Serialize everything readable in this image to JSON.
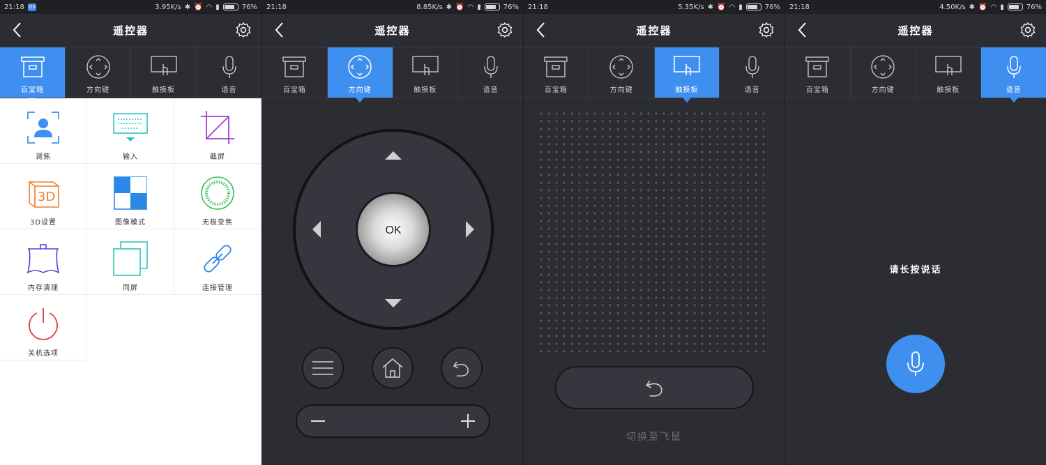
{
  "screens": [
    {
      "time": "21:18",
      "speed": "3.95K/s",
      "battery": "76%",
      "notification": "Ob"
    },
    {
      "time": "21:18",
      "speed": "8.85K/s",
      "battery": "76%"
    },
    {
      "time": "21:18",
      "speed": "5.35K/s",
      "battery": "76%"
    },
    {
      "time": "21:18",
      "speed": "4.50K/s",
      "battery": "76%"
    }
  ],
  "header": {
    "title": "遥控器"
  },
  "tabs": [
    "百宝箱",
    "方向键",
    "触摸板",
    "语音"
  ],
  "toolbox": {
    "items": [
      "调焦",
      "输入",
      "截屏",
      "3D设置",
      "图像模式",
      "无极变焦",
      "内存清理",
      "同屏",
      "连接管理",
      "关机选项"
    ]
  },
  "dpad": {
    "ok_label": "OK"
  },
  "touchpad": {
    "switch_label": "切换至飞鼠"
  },
  "voice": {
    "hint": "请长按说话"
  },
  "colors": {
    "accent": "#3f8ff0",
    "panel_bg": "#2c2d33",
    "toolbox_bg": "#ffffff"
  }
}
